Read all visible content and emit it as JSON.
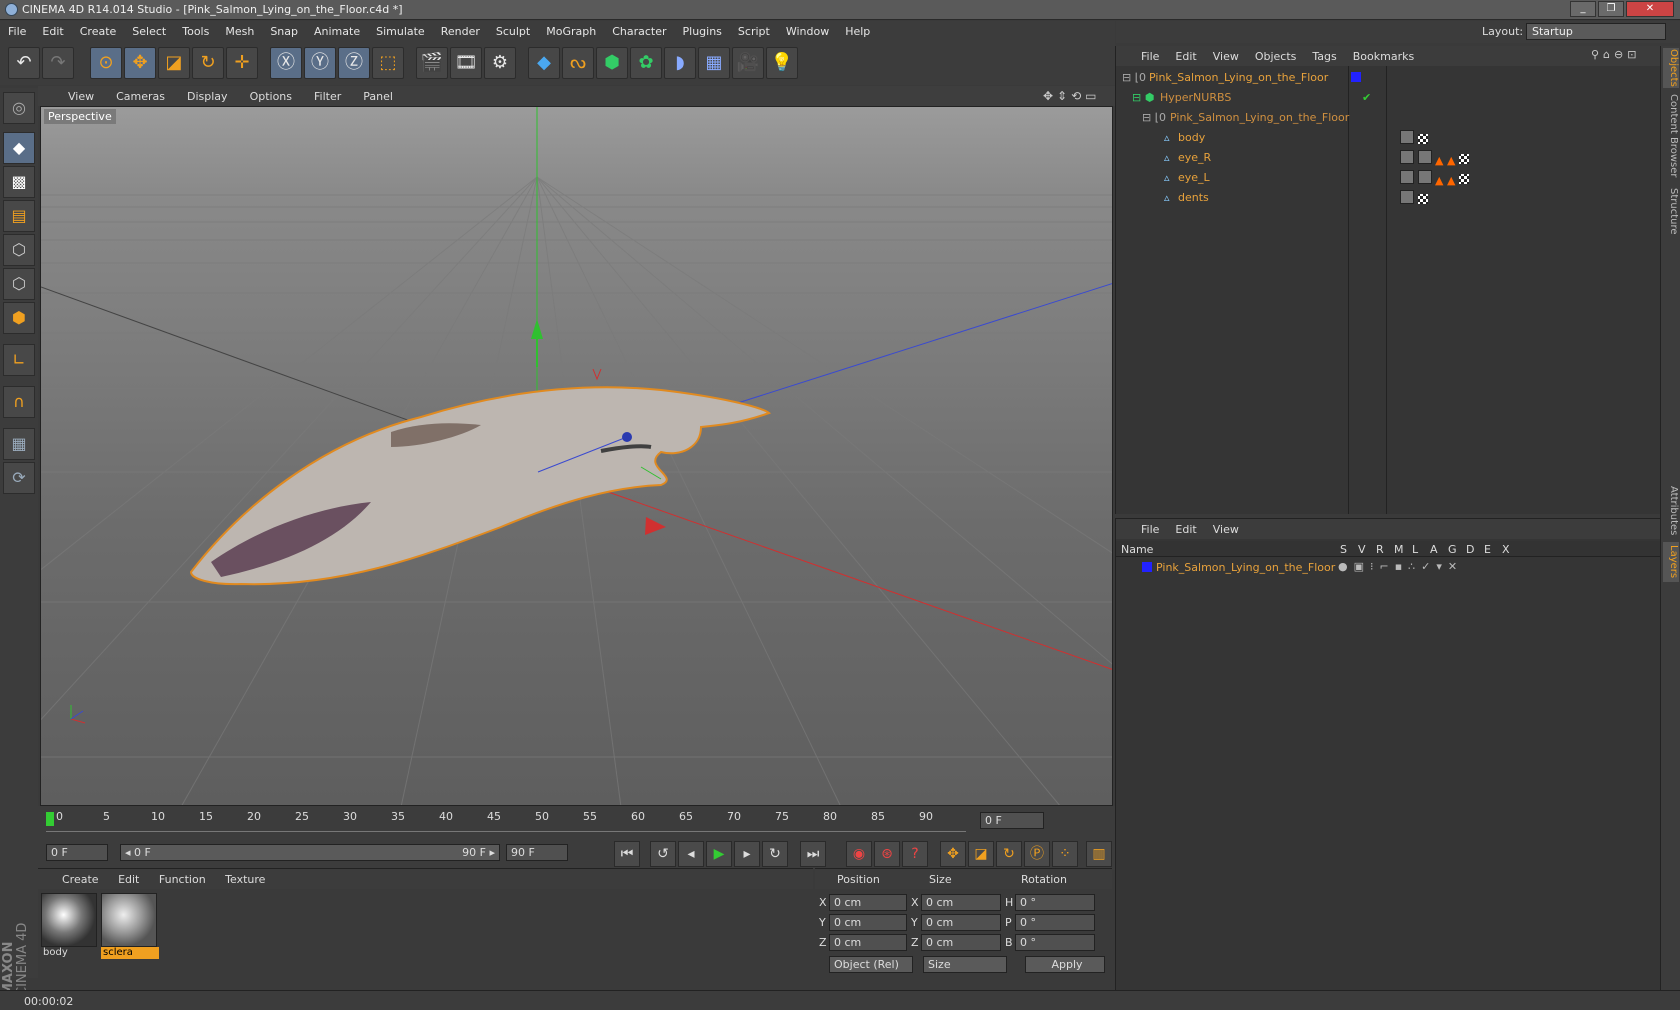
{
  "app": {
    "title": "CINEMA 4D R14.014 Studio - [Pink_Salmon_Lying_on_the_Floor.c4d *]",
    "window_controls": [
      "_",
      "❐",
      "✕"
    ]
  },
  "menubar": [
    "File",
    "Edit",
    "Create",
    "Select",
    "Tools",
    "Mesh",
    "Snap",
    "Animate",
    "Simulate",
    "Render",
    "Sculpt",
    "MoGraph",
    "Character",
    "Plugins",
    "Script",
    "Window",
    "Help"
  ],
  "layout": {
    "label": "Layout:",
    "value": "Startup"
  },
  "viewport": {
    "menu": [
      "View",
      "Cameras",
      "Display",
      "Options",
      "Filter",
      "Panel"
    ],
    "label": "Perspective"
  },
  "timeline": {
    "ticks": [
      "0",
      "5",
      "10",
      "15",
      "20",
      "25",
      "30",
      "35",
      "40",
      "45",
      "50",
      "55",
      "60",
      "65",
      "70",
      "75",
      "80",
      "85",
      "90"
    ],
    "current_frame": "0 F"
  },
  "transport": {
    "start_field": "0 F",
    "range_start": "◂ 0 F",
    "range_end": "90 F ▸",
    "end_field": "90 F"
  },
  "materials": {
    "menu": [
      "Create",
      "Edit",
      "Function",
      "Texture"
    ],
    "items": [
      {
        "name": "body",
        "selected": false
      },
      {
        "name": "sclera",
        "selected": true
      }
    ]
  },
  "coordinates": {
    "headers": [
      "Position",
      "Size",
      "Rotation"
    ],
    "rows": [
      {
        "axis": "X",
        "pos": "0 cm",
        "saxis": "X",
        "size": "0 cm",
        "raxis": "H",
        "rot": "0 °"
      },
      {
        "axis": "Y",
        "pos": "0 cm",
        "saxis": "Y",
        "size": "0 cm",
        "raxis": "P",
        "rot": "0 °"
      },
      {
        "axis": "Z",
        "pos": "0 cm",
        "saxis": "Z",
        "size": "0 cm",
        "raxis": "B",
        "rot": "0 °"
      }
    ],
    "mode": "Object (Rel)",
    "size_mode": "Size",
    "apply": "Apply"
  },
  "objects_panel": {
    "menu": [
      "File",
      "Edit",
      "View",
      "Objects",
      "Tags",
      "Bookmarks"
    ],
    "rows": [
      {
        "name": "Pink_Salmon_Lying_on_the_Floor"
      },
      {
        "name": "HyperNURBS"
      },
      {
        "name": "Pink_Salmon_Lying_on_the_Floor"
      },
      {
        "name": "body"
      },
      {
        "name": "eye_R"
      },
      {
        "name": "eye_L"
      },
      {
        "name": "dents"
      }
    ]
  },
  "layers_panel": {
    "menu": [
      "File",
      "Edit",
      "View"
    ],
    "columns": {
      "name": "Name",
      "flags": [
        "S",
        "V",
        "R",
        "M",
        "L",
        "A",
        "G",
        "D",
        "E",
        "X"
      ]
    },
    "rows": [
      {
        "name": "Pink_Salmon_Lying_on_the_Floor",
        "color": "#2233ff"
      }
    ]
  },
  "side_tabs": [
    "Objects",
    "Content Browser",
    "Structure",
    "Attributes",
    "Layers"
  ],
  "branding": {
    "line1": "MAXON",
    "line2": "CINEMA 4D"
  },
  "status": {
    "time": "00:00:02"
  },
  "colors": {
    "accent": "#f0a020",
    "selection": "#e8a23c",
    "axis_x": "#e03030",
    "axis_y": "#30d030",
    "axis_z": "#3050e0"
  }
}
